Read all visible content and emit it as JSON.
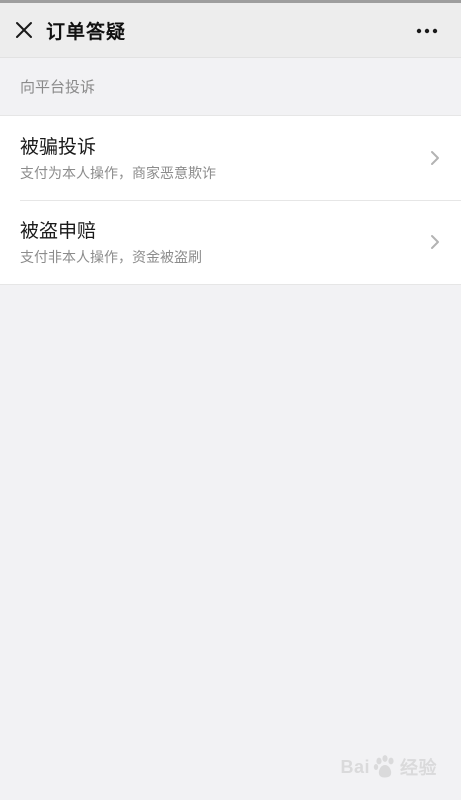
{
  "nav": {
    "title": "订单答疑",
    "close_icon": "close-icon",
    "more_icon": "more-horizontal-icon"
  },
  "section": {
    "header": "向平台投诉"
  },
  "items": [
    {
      "title": "被骗投诉",
      "description": "支付为本人操作，商家恶意欺诈",
      "icon": "chevron-right-icon"
    },
    {
      "title": "被盗申赔",
      "description": "支付非本人操作，资金被盗刷",
      "icon": "chevron-right-icon"
    }
  ],
  "watermark": {
    "text_left": "Bai",
    "text_right": "经验",
    "icon": "baidu-paw-logo"
  },
  "colors": {
    "nav_background": "#ededed",
    "page_background": "#f2f2f4",
    "card_background": "#ffffff",
    "secondary_text": "#8c8c8c"
  }
}
